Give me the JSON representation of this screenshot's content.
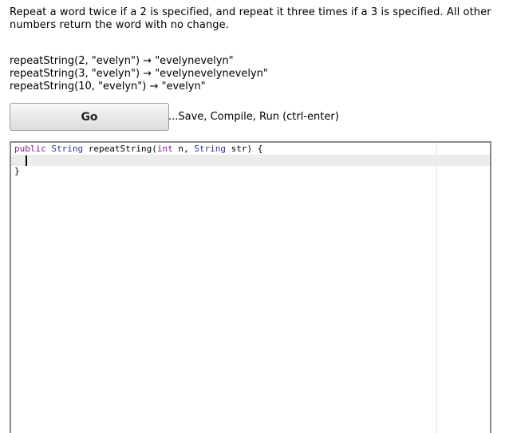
{
  "problem": {
    "description": "Repeat a word twice if a 2 is specified, and repeat it three times if a 3 is specified. All other numbers return the word with no change.",
    "examples": [
      "repeatString(2, \"evelyn\") → \"evelynevelyn\"",
      "repeatString(3, \"evelyn\") → \"evelynevelynevelyn\"",
      "repeatString(10, \"evelyn\") → \"evelyn\""
    ]
  },
  "actions": {
    "go_label": "Go",
    "run_hint": "...Save, Compile, Run (ctrl-enter)"
  },
  "editor": {
    "signature": {
      "kw_public": "public",
      "type_string": "String",
      "name": "repeatString(",
      "kw_int": "int",
      "param_n": " n, ",
      "type_string2": "String",
      "param_str": " str) {"
    },
    "closing_brace": "}",
    "colors": {
      "keyword": "#8b1c8b",
      "type": "#333399",
      "active_line": "#ececec"
    }
  }
}
